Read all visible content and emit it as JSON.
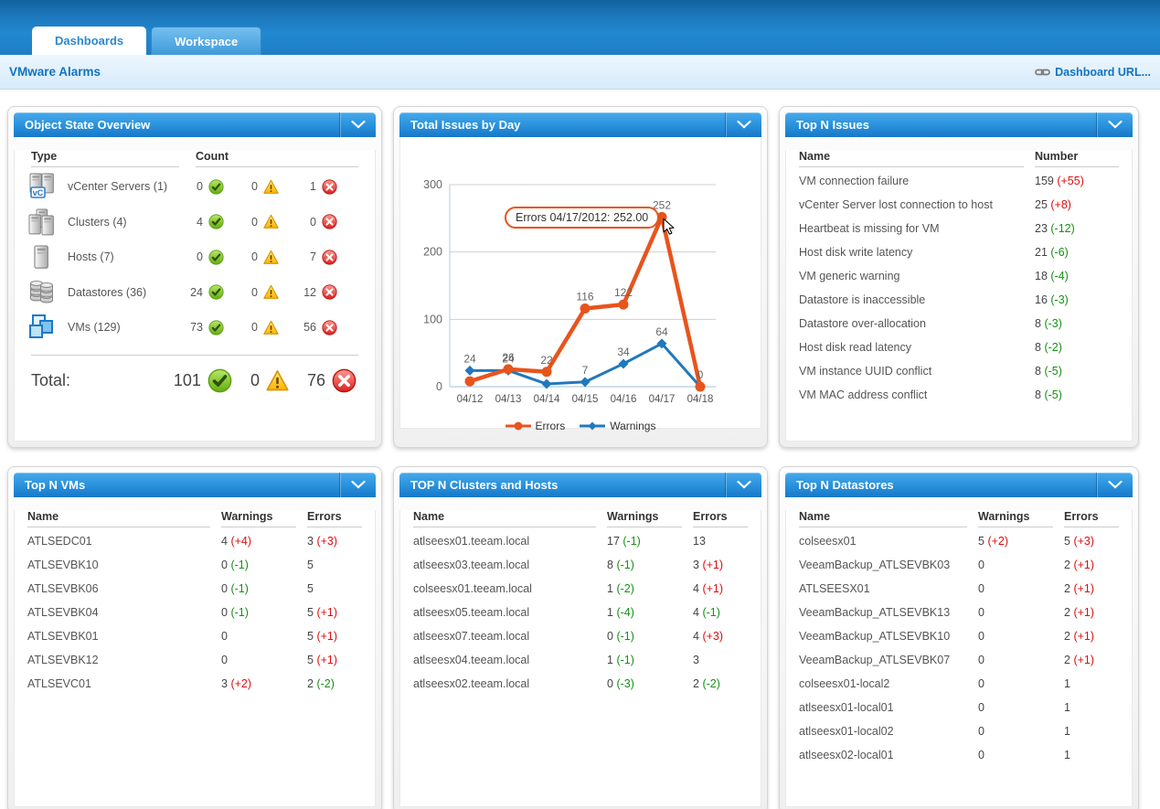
{
  "tabs": [
    {
      "label": "Dashboards",
      "active": true
    },
    {
      "label": "Workspace",
      "active": false
    }
  ],
  "page": {
    "title": "VMware Alarms",
    "dashboard_url_label": "Dashboard URL..."
  },
  "panels": {
    "object_state": {
      "title": "Object State Overview",
      "columns": {
        "type": "Type",
        "count": "Count"
      },
      "rows": [
        {
          "icon": "vcenter-servers-icon",
          "label": "vCenter Servers (1)",
          "ok": 0,
          "warn": 0,
          "err": 1
        },
        {
          "icon": "clusters-icon",
          "label": "Clusters (4)",
          "ok": 4,
          "warn": 0,
          "err": 0
        },
        {
          "icon": "hosts-icon",
          "label": "Hosts (7)",
          "ok": 0,
          "warn": 0,
          "err": 7
        },
        {
          "icon": "datastores-icon",
          "label": "Datastores (36)",
          "ok": 24,
          "warn": 0,
          "err": 12
        },
        {
          "icon": "vms-icon",
          "label": "VMs (129)",
          "ok": 73,
          "warn": 0,
          "err": 56
        }
      ],
      "total": {
        "label": "Total:",
        "ok": 101,
        "warn": 0,
        "err": 76
      }
    },
    "issues_by_day": {
      "title": "Total Issues by Day"
    },
    "top_issues": {
      "title": "Top N Issues",
      "columns": [
        "Name",
        "Number"
      ],
      "rows": [
        {
          "name": "VM connection failure",
          "value": 159,
          "delta": "+55"
        },
        {
          "name": "vCenter Server lost connection to host",
          "value": 25,
          "delta": "+8"
        },
        {
          "name": "Heartbeat is missing for VM",
          "value": 23,
          "delta": "-12"
        },
        {
          "name": "Host disk write latency",
          "value": 21,
          "delta": "-6"
        },
        {
          "name": "VM generic warning",
          "value": 18,
          "delta": "-4"
        },
        {
          "name": "Datastore is inaccessible",
          "value": 16,
          "delta": "-3"
        },
        {
          "name": "Datastore over-allocation",
          "value": 8,
          "delta": "-3"
        },
        {
          "name": "Host disk read latency",
          "value": 8,
          "delta": "-2"
        },
        {
          "name": "VM instance UUID conflict",
          "value": 8,
          "delta": "-5"
        },
        {
          "name": "VM MAC address conflict",
          "value": 8,
          "delta": "-5"
        }
      ]
    },
    "top_vms": {
      "title": "Top N VMs",
      "columns": [
        "Name",
        "Warnings",
        "Errors"
      ],
      "rows": [
        {
          "name": "ATLSEDC01",
          "w": 4,
          "wd": "+4",
          "e": 3,
          "ed": "+3"
        },
        {
          "name": "ATLSEVBK10",
          "w": 0,
          "wd": "-1",
          "e": 5,
          "ed": null
        },
        {
          "name": "ATLSEVBK06",
          "w": 0,
          "wd": "-1",
          "e": 5,
          "ed": null
        },
        {
          "name": "ATLSEVBK04",
          "w": 0,
          "wd": "-1",
          "e": 5,
          "ed": "+1"
        },
        {
          "name": "ATLSEVBK01",
          "w": 0,
          "wd": null,
          "e": 5,
          "ed": "+1"
        },
        {
          "name": "ATLSEVBK12",
          "w": 0,
          "wd": null,
          "e": 5,
          "ed": "+1"
        },
        {
          "name": "ATLSEVC01",
          "w": 3,
          "wd": "+2",
          "e": 2,
          "ed": "-2"
        }
      ]
    },
    "top_clusters": {
      "title": "TOP N Clusters and Hosts",
      "columns": [
        "Name",
        "Warnings",
        "Errors"
      ],
      "rows": [
        {
          "name": "atlseesx01.teeam.local",
          "w": 17,
          "wd": "-1",
          "e": 13,
          "ed": null
        },
        {
          "name": "atlseesx03.teeam.local",
          "w": 8,
          "wd": "-1",
          "e": 3,
          "ed": "+1"
        },
        {
          "name": "colseesx01.teeam.local",
          "w": 1,
          "wd": "-2",
          "e": 4,
          "ed": "+1"
        },
        {
          "name": "atlseesx05.teeam.local",
          "w": 1,
          "wd": "-4",
          "e": 4,
          "ed": "-1"
        },
        {
          "name": "atlseesx07.teeam.local",
          "w": 0,
          "wd": "-1",
          "e": 4,
          "ed": "+3"
        },
        {
          "name": "atlseesx04.teeam.local",
          "w": 1,
          "wd": "-1",
          "e": 3,
          "ed": null
        },
        {
          "name": "atlseesx02.teeam.local",
          "w": 0,
          "wd": "-3",
          "e": 2,
          "ed": "-2"
        }
      ]
    },
    "top_datastores": {
      "title": "Top N Datastores",
      "columns": [
        "Name",
        "Warnings",
        "Errors"
      ],
      "rows": [
        {
          "name": "colseesx01",
          "w": 5,
          "wd": "+2",
          "e": 5,
          "ed": "+3"
        },
        {
          "name": "VeeamBackup_ATLSEVBK03",
          "w": 0,
          "wd": null,
          "e": 2,
          "ed": "+1"
        },
        {
          "name": "ATLSEESX01",
          "w": 0,
          "wd": null,
          "e": 2,
          "ed": "+1"
        },
        {
          "name": "VeeamBackup_ATLSEVBK13",
          "w": 0,
          "wd": null,
          "e": 2,
          "ed": "+1"
        },
        {
          "name": "VeeamBackup_ATLSEVBK10",
          "w": 0,
          "wd": null,
          "e": 2,
          "ed": "+1"
        },
        {
          "name": "VeeamBackup_ATLSEVBK07",
          "w": 0,
          "wd": null,
          "e": 2,
          "ed": "+1"
        },
        {
          "name": "colseesx01-local2",
          "w": 0,
          "wd": null,
          "e": 1,
          "ed": null
        },
        {
          "name": "atlseesx01-local01",
          "w": 0,
          "wd": null,
          "e": 1,
          "ed": null
        },
        {
          "name": "atlseesx01-local02",
          "w": 0,
          "wd": null,
          "e": 1,
          "ed": null
        },
        {
          "name": "atlseesx02-local01",
          "w": 0,
          "wd": null,
          "e": 1,
          "ed": null
        }
      ]
    }
  },
  "chart_data": {
    "type": "line",
    "title": "Total Issues by Day",
    "x": [
      "04/12",
      "04/13",
      "04/14",
      "04/15",
      "04/16",
      "04/17",
      "04/18"
    ],
    "series": [
      {
        "name": "Warnings",
        "color": "#2078be",
        "marker": "diamond",
        "values": [
          24,
          24,
          4,
          7,
          34,
          64,
          0
        ],
        "labels": [
          "24",
          "24",
          "4",
          "7",
          "34",
          "64",
          ""
        ]
      },
      {
        "name": "Errors",
        "color": "#e8541d",
        "marker": "circle",
        "values": [
          8,
          26,
          22,
          116,
          122,
          252,
          0
        ],
        "labels": [
          "",
          "26",
          "22",
          "116",
          "122",
          "252",
          "0"
        ]
      }
    ],
    "ylim": [
      0,
      300
    ],
    "yticks": [
      0,
      100,
      200,
      300
    ],
    "grid": true,
    "legend": [
      "Errors",
      "Warnings"
    ],
    "legend_position": "bottom",
    "tooltip": {
      "text": "Errors 04/17/2012: 252.00",
      "target_series": "Errors",
      "target_x": "04/17",
      "value": 252.0
    }
  }
}
